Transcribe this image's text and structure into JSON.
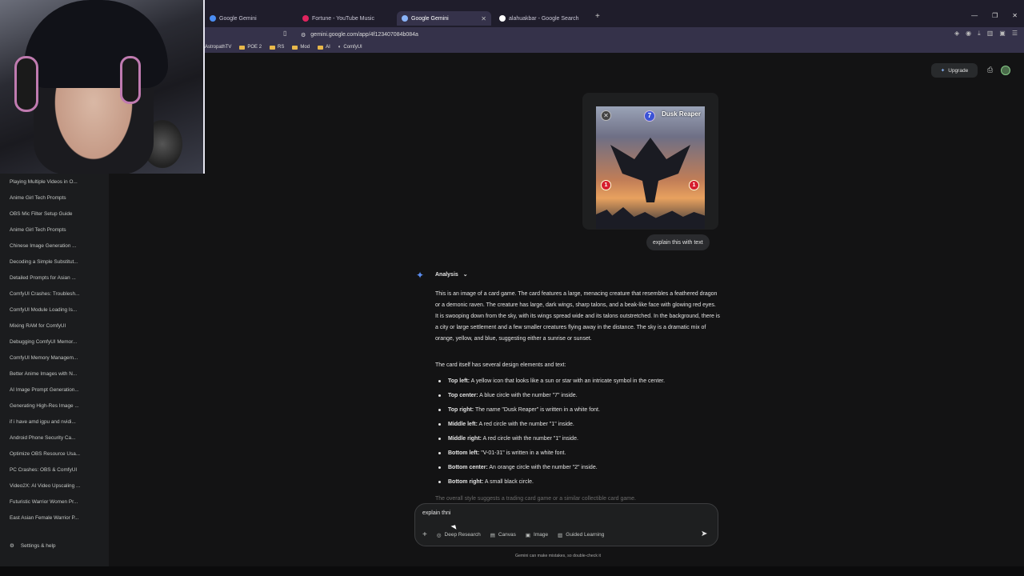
{
  "browser": {
    "tabs": [
      {
        "label": "Google Gemini",
        "fav": "#4b8df2"
      },
      {
        "label": "Fortune - YouTube Music",
        "fav": "#e0245e"
      },
      {
        "label": "Google Gemini",
        "fav": "#8ab4f8",
        "active": true
      },
      {
        "label": "alahuakbar - Google Search",
        "fav": "#ffffff"
      }
    ],
    "url": "gemini.google.com/app/4f123407084b084a",
    "bookmarks": [
      "AstropathTV",
      "POE 2",
      "RS",
      "Mod",
      "AI",
      "ComfyUI"
    ]
  },
  "sidebar": {
    "items": [
      "Playing Multiple Videos in O...",
      "Anime Girl Tech Prompts",
      "OBS Mic Filter Setup Guide",
      "Anime Girl Tech Prompts",
      "Chinese Image Generation ...",
      "Decoding a Simple Substitut...",
      "Detailed Prompts for Asian ...",
      "ComfyUI Crashes: Troublesh...",
      "ComfyUI Module Loading Is...",
      "Mixing RAM for ComfyUI",
      "Debugging ComfyUI Memor...",
      "ComfyUI Memory Managem...",
      "Better Anime Images with N...",
      "AI Image Prompt Generation...",
      "Generating High-Res Image ...",
      "if i have amd igpu and nvidi...",
      "Android Phone Security Ca...",
      "Optimize OBS Resource Usa...",
      "PC Crashes: OBS & ComfyUI",
      "Video2X: AI Video Upscaling ...",
      "Futuristic Warrior Women Pr...",
      "East Asian Female Warrior P..."
    ],
    "settings_label": "Settings & help"
  },
  "header": {
    "upgrade_label": "Upgrade"
  },
  "card": {
    "name": "Dusk Reaper",
    "cost": "7",
    "left_value": "1",
    "right_value": "1"
  },
  "user_message": "explain this with text",
  "response": {
    "section_label": "Analysis",
    "paragraph1": "This is an image of a card game. The card features a large, menacing creature that resembles a feathered dragon or a demonic raven. The creature has large, dark wings, sharp talons, and a beak-like face with glowing red eyes. It is swooping down from the sky, with its wings spread wide and its talons outstretched. In the background, there is a city or large settlement and a few smaller creatures flying away in the distance. The sky is a dramatic mix of orange, yellow, and blue, suggesting either a sunrise or sunset.",
    "paragraph2": "The card itself has several design elements and text:",
    "bullets": [
      {
        "label": "Top left:",
        "text": " A yellow icon that looks like a sun or star with an intricate symbol in the center."
      },
      {
        "label": "Top center:",
        "text": " A blue circle with the number \"7\" inside."
      },
      {
        "label": "Top right:",
        "text": " The name \"Dusk Reaper\" is written in a white font."
      },
      {
        "label": "Middle left:",
        "text": " A red circle with the number \"1\" inside."
      },
      {
        "label": "Middle right:",
        "text": " A red circle with the number \"1\" inside."
      },
      {
        "label": "Bottom left:",
        "text": " \"V-01-31\" is written in a white font."
      },
      {
        "label": "Bottom center:",
        "text": " An orange circle with the number \"2\" inside."
      },
      {
        "label": "Bottom right:",
        "text": " A small black circle."
      }
    ],
    "fade_text": "The overall style suggests a trading card game or a similar collectible card game."
  },
  "composer": {
    "text": "explain thni",
    "tools": [
      "Deep Research",
      "Canvas",
      "Image",
      "Guided Learning"
    ]
  },
  "disclaimer": "Gemini can make mistakes, so double-check it"
}
